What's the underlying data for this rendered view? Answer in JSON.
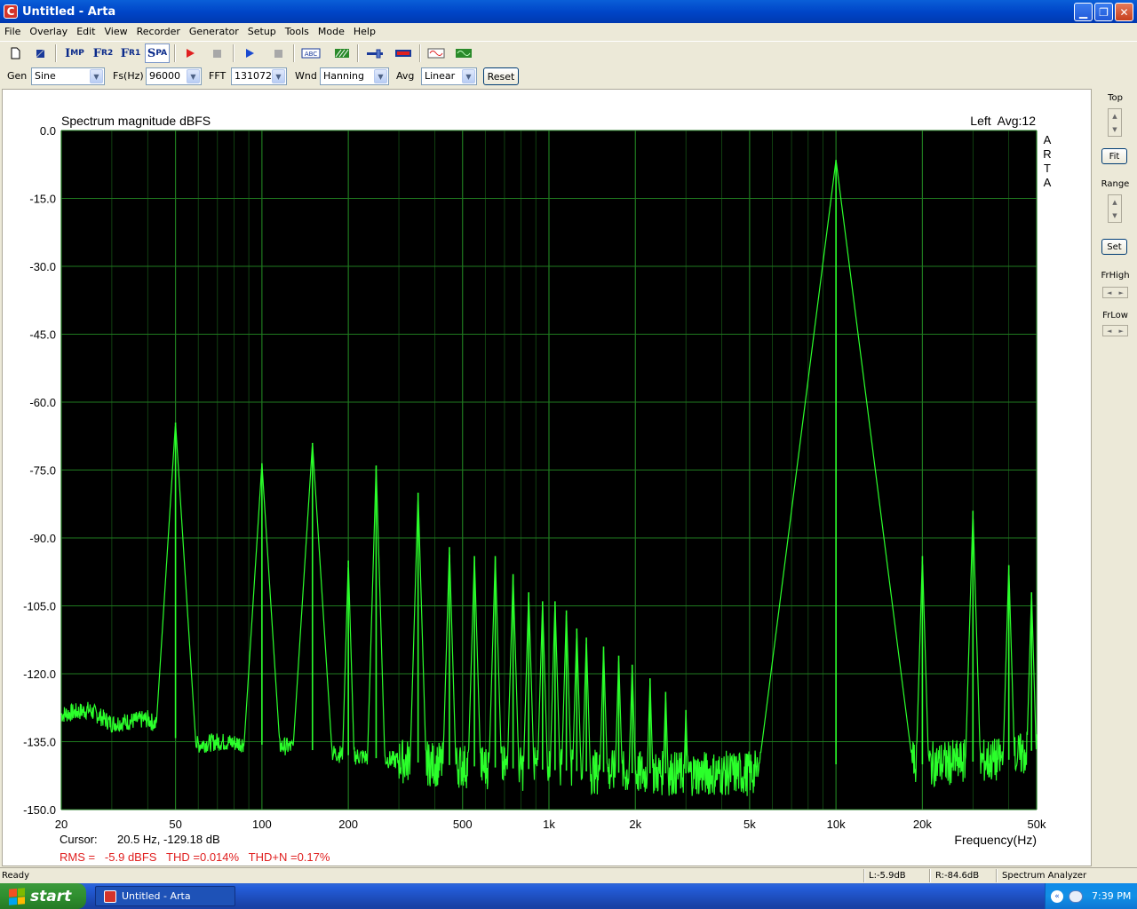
{
  "window": {
    "title": "Untitled - Arta",
    "app_icon_letter": "C",
    "min_glyph": "▁",
    "max_glyph": "❐",
    "close_glyph": "✕"
  },
  "menu": [
    "File",
    "Overlay",
    "Edit",
    "View",
    "Recorder",
    "Generator",
    "Setup",
    "Tools",
    "Mode",
    "Help"
  ],
  "toolbar": {
    "imp": {
      "big": "I",
      "small": "MP"
    },
    "fr2": {
      "big": "F",
      "small": "R2"
    },
    "fr1": {
      "big": "F",
      "small": "R1"
    },
    "spa": {
      "big": "S",
      "small": "PA"
    },
    "abc": "ABC"
  },
  "controls": {
    "gen_label": "Gen",
    "gen_value": "Sine",
    "fs_label": "Fs(Hz)",
    "fs_value": "96000",
    "fft_label": "FFT",
    "fft_value": "131072",
    "wnd_label": "Wnd",
    "wnd_value": "Hanning",
    "avg_label": "Avg",
    "avg_value": "Linear",
    "reset_label": "Reset",
    "dropdown_glyph": "▼"
  },
  "plot": {
    "title": "Spectrum magnitude dBFS",
    "channel_info": "Left  Avg:12",
    "side_letters": [
      "A",
      "R",
      "T",
      "A"
    ],
    "xlabel": "Frequency(Hz)",
    "cursor_label": "Cursor:",
    "cursor_value": "20.5 Hz, -129.18 dB",
    "metrics": "RMS =   -5.9 dBFS   THD =0.014%   THD+N =0.17%"
  },
  "chart_data": {
    "type": "line",
    "title": "Spectrum magnitude dBFS",
    "xlabel": "Frequency(Hz)",
    "ylabel": "",
    "x_scale": "log",
    "xlim": [
      20,
      50000
    ],
    "ylim": [
      -150,
      0
    ],
    "grid": true,
    "x_ticks": [
      "20",
      "50",
      "100",
      "200",
      "500",
      "1k",
      "2k",
      "5k",
      "10k",
      "20k",
      "50k"
    ],
    "x_tick_values": [
      20,
      50,
      100,
      200,
      500,
      1000,
      2000,
      5000,
      10000,
      20000,
      50000
    ],
    "y_ticks": [
      "0.0",
      "-15.0",
      "-30.0",
      "-45.0",
      "-60.0",
      "-75.0",
      "-90.0",
      "-105.0",
      "-120.0",
      "-135.0",
      "-150.0"
    ],
    "y_tick_values": [
      0,
      -15,
      -30,
      -45,
      -60,
      -75,
      -90,
      -105,
      -120,
      -135,
      -150
    ],
    "noise_floor": [
      [
        20,
        -129
      ],
      [
        25,
        -128
      ],
      [
        30,
        -131
      ],
      [
        40,
        -130
      ],
      [
        55,
        -136
      ],
      [
        70,
        -135
      ],
      [
        120,
        -136
      ],
      [
        200,
        -138
      ],
      [
        400,
        -140
      ],
      [
        800,
        -141
      ],
      [
        2000,
        -142
      ],
      [
        5000,
        -142
      ],
      [
        10000,
        -140
      ],
      [
        20000,
        -140
      ],
      [
        40000,
        -139
      ],
      [
        48000,
        -137
      ]
    ],
    "series": [
      {
        "color": "#2bff2b",
        "peaks": [
          {
            "x": 50,
            "y": -64.5
          },
          {
            "x": 100,
            "y": -73.5
          },
          {
            "x": 150,
            "y": -69
          },
          {
            "x": 200,
            "y": -95
          },
          {
            "x": 250,
            "y": -74
          },
          {
            "x": 350,
            "y": -80
          },
          {
            "x": 450,
            "y": -92
          },
          {
            "x": 550,
            "y": -94
          },
          {
            "x": 650,
            "y": -94
          },
          {
            "x": 750,
            "y": -98
          },
          {
            "x": 850,
            "y": -102
          },
          {
            "x": 950,
            "y": -104
          },
          {
            "x": 1050,
            "y": -104
          },
          {
            "x": 1150,
            "y": -106
          },
          {
            "x": 1250,
            "y": -110
          },
          {
            "x": 1350,
            "y": -112
          },
          {
            "x": 1550,
            "y": -114
          },
          {
            "x": 1750,
            "y": -116
          },
          {
            "x": 1950,
            "y": -118
          },
          {
            "x": 2250,
            "y": -121
          },
          {
            "x": 2550,
            "y": -124
          },
          {
            "x": 3000,
            "y": -128
          },
          {
            "x": 10000,
            "y": -6.5
          },
          {
            "x": 20000,
            "y": -94
          },
          {
            "x": 30000,
            "y": -84
          },
          {
            "x": 40000,
            "y": -96
          },
          {
            "x": 48000,
            "y": -102
          }
        ]
      }
    ]
  },
  "right_panel": {
    "top_label": "Top",
    "fit_label": "Fit",
    "range_label": "Range",
    "set_label": "Set",
    "frhigh_label": "FrHigh",
    "frlow_label": "FrLow",
    "up_glyph": "▲",
    "down_glyph": "▼",
    "left_glyph": "◄",
    "right_glyph": "►"
  },
  "status": {
    "ready": "Ready",
    "left_level": "L:-5.9dB",
    "right_level": "R:-84.6dB",
    "mode": "Spectrum Analyzer"
  },
  "taskbar": {
    "start": "start",
    "task": "Untitled - Arta",
    "tray_arrow": "«",
    "clock": "7:39 PM"
  },
  "colors": {
    "plot_bg": "#000000",
    "grid": "#1f7a1f",
    "trace": "#2bff2b",
    "metrics_text": "#e02020"
  }
}
